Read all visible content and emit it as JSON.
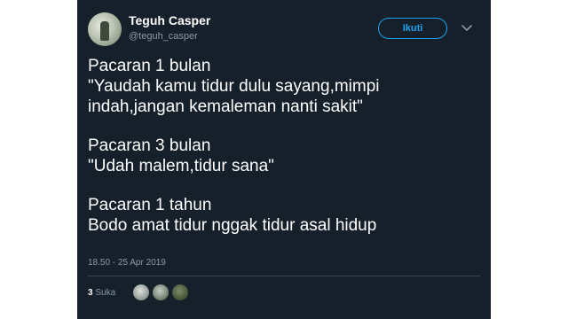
{
  "user": {
    "name": "Teguh Casper",
    "handle": "@teguh_casper"
  },
  "actions": {
    "follow_label": "Ikuti"
  },
  "tweet": {
    "blocks": [
      {
        "line1": "Pacaran 1 bulan",
        "line2": "\"Yaudah kamu tidur dulu sayang,mimpi",
        "line3": "indah,jangan kemaleman nanti sakit\""
      },
      {
        "line1": "Pacaran 3 bulan",
        "line2": "\"Udah malem,tidur sana\""
      },
      {
        "line1": "Pacaran 1 tahun",
        "line2": "Bodo amat tidur nggak tidur asal hidup"
      }
    ],
    "timestamp": "18.50 - 25 Apr 2019"
  },
  "stats": {
    "likes_count": "3",
    "likes_label": "Suka"
  },
  "icons": {
    "caret": "chevron-down-icon"
  },
  "colors": {
    "background": "#15202b",
    "accent": "#1da1f2",
    "muted": "#8899a6"
  }
}
